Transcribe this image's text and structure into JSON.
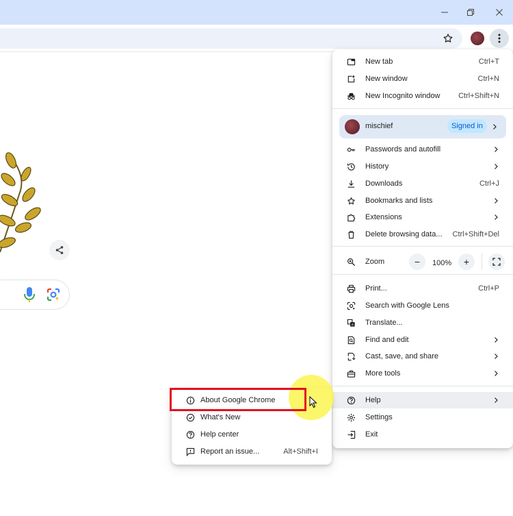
{
  "colors": {
    "titlebar": "#d3e3fd",
    "omnibox": "#edf2fa",
    "signed_in_badge_bg": "#c2e7ff",
    "signed_in_badge_text": "#0b57d0",
    "highlight_box": "#e3101e",
    "cursor_glow": "#fcf550"
  },
  "window_controls": {
    "minimize_icon": "minimize-icon",
    "restore_icon": "restore-icon",
    "close_icon": "close-icon"
  },
  "toolbar": {
    "star_icon": "star-icon",
    "menu_icon": "kebab-menu-icon"
  },
  "main_menu": {
    "group1": [
      {
        "label": "New tab",
        "shortcut": "Ctrl+T",
        "icon": "new-tab-icon"
      },
      {
        "label": "New window",
        "shortcut": "Ctrl+N",
        "icon": "new-window-icon"
      },
      {
        "label": "New Incognito window",
        "shortcut": "Ctrl+Shift+N",
        "icon": "incognito-icon"
      }
    ],
    "profile": {
      "name": "mischief",
      "badge": "Signed in"
    },
    "group2": [
      {
        "label": "Passwords and autofill",
        "icon": "key-icon"
      },
      {
        "label": "History",
        "icon": "history-icon"
      },
      {
        "label": "Downloads",
        "shortcut": "Ctrl+J",
        "icon": "download-icon"
      },
      {
        "label": "Bookmarks and lists",
        "icon": "star-icon"
      },
      {
        "label": "Extensions",
        "icon": "puzzle-icon"
      },
      {
        "label": "Delete browsing data...",
        "shortcut": "Ctrl+Shift+Del",
        "icon": "trash-icon"
      }
    ],
    "zoom": {
      "label": "Zoom",
      "minus": "−",
      "value": "100%",
      "plus": "+"
    },
    "group3": [
      {
        "label": "Print...",
        "shortcut": "Ctrl+P",
        "icon": "print-icon"
      },
      {
        "label": "Search with Google Lens",
        "icon": "lens-icon"
      },
      {
        "label": "Translate...",
        "icon": "translate-icon"
      },
      {
        "label": "Find and edit",
        "icon": "find-icon"
      },
      {
        "label": "Cast, save, and share",
        "icon": "cast-icon"
      },
      {
        "label": "More tools",
        "icon": "toolbox-icon"
      }
    ],
    "group4": [
      {
        "label": "Help",
        "icon": "help-icon"
      },
      {
        "label": "Settings",
        "icon": "settings-icon"
      },
      {
        "label": "Exit",
        "icon": "exit-icon"
      }
    ]
  },
  "help_submenu": [
    {
      "label": "About Google Chrome",
      "icon": "info-icon"
    },
    {
      "label": "What's New",
      "icon": "whats-new-icon"
    },
    {
      "label": "Help center",
      "icon": "help-icon"
    },
    {
      "label": "Report an issue...",
      "shortcut": "Alt+Shift+I",
      "icon": "report-icon"
    }
  ]
}
